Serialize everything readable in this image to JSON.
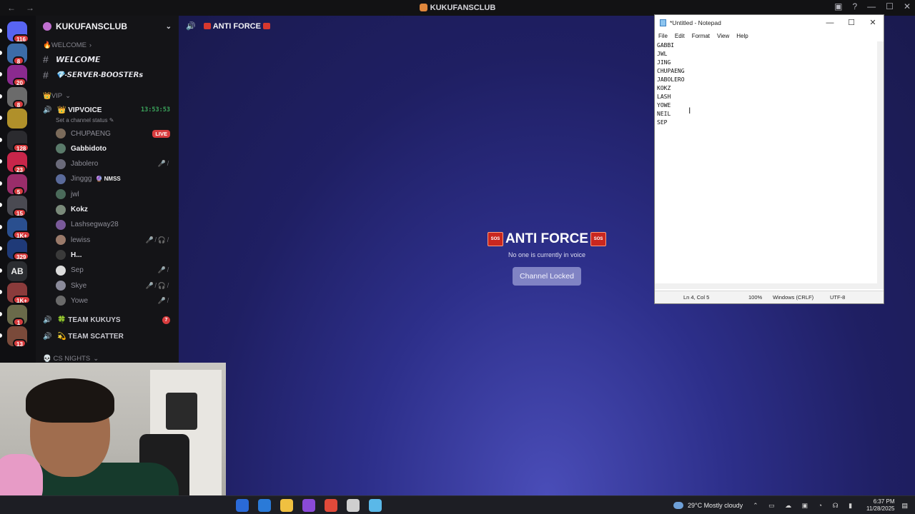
{
  "window": {
    "title": "KUKUFANSCLUB",
    "nav_back": "←",
    "nav_forward": "→",
    "controls": [
      "—",
      "☐",
      "✕"
    ]
  },
  "rail": {
    "servers": [
      {
        "badge": "116",
        "color": "#5865f2"
      },
      {
        "badge": "8",
        "color": "#3c6ca8"
      },
      {
        "badge": "20",
        "color": "#8b2a8f"
      },
      {
        "badge": "8",
        "color": "#6b6b6b"
      },
      {
        "badge": "",
        "color": "#b0902a"
      },
      {
        "badge": "128",
        "color": "#2b2b2f"
      },
      {
        "badge": "23",
        "color": "#c8264a"
      },
      {
        "badge": "5",
        "color": "#9a2d6a"
      },
      {
        "badge": "15",
        "color": "#4a4a52"
      },
      {
        "badge": "1K+",
        "color": "#2a4f8f"
      },
      {
        "badge": "329",
        "color": "#1f3a78"
      },
      {
        "badge": "",
        "color": "#2b2d31",
        "label": "AB"
      },
      {
        "badge": "1K+",
        "color": "#8a3b3b"
      },
      {
        "badge": "1",
        "color": "#6a6a4a"
      },
      {
        "badge": "13",
        "color": "#7a4a3a"
      }
    ]
  },
  "sidebar": {
    "guild_name": "KUKUFANSCLUB",
    "categories": {
      "welcome": "🔥WELCOME",
      "vip": "👑VIP",
      "cs_nights": "💀 CS NIGHTS"
    },
    "channels": [
      {
        "name": "𝙒𝙀𝙇𝘾𝙊𝙈𝙀"
      },
      {
        "name": "💎-𝙎𝙀𝙍𝙑𝙀𝙍-𝘽𝙊𝙊𝙎𝙏𝙀𝙍𝙨"
      }
    ],
    "voice": {
      "name": "👑 VIPVOICE",
      "timer": "13:53:53",
      "status_hint": "Set a channel status ✎"
    },
    "members": [
      {
        "name": "CHUPAENG",
        "live": "LIVE",
        "color": "#7a6a5a"
      },
      {
        "name": "Gabbidoto",
        "bright": true,
        "color": "#5a7a6a"
      },
      {
        "name": "Jabolero",
        "mutes": "🎤̸",
        "color": "#6a6a7a"
      },
      {
        "name": "Jinggg",
        "tag": "🔮 NMSS",
        "color": "#5a6a9a"
      },
      {
        "name": "jwl",
        "color": "#4a6a5a"
      },
      {
        "name": "Kokz",
        "bright": true,
        "color": "#7a8a7a"
      },
      {
        "name": "Lashsegway28",
        "color": "#7a5a9a"
      },
      {
        "name": "lewiss",
        "mutes": "🎤̸🎧̸",
        "color": "#9a7a6a"
      },
      {
        "name": "H...",
        "bright": true,
        "color": "#3a3a3a"
      },
      {
        "name": "Sep",
        "mutes": "🎤̸",
        "color": "#dcdcdc"
      },
      {
        "name": "Skye",
        "mutes": "🎤̸🎧̸",
        "color": "#8a8a9a"
      },
      {
        "name": "Yowe",
        "mutes": "🎤̸",
        "color": "#6a6a6a"
      }
    ],
    "team_channels": [
      {
        "name": "🍀 TEAM KUKUYS",
        "count": "7"
      },
      {
        "name": "💫 TEAM SCATTER",
        "count": ""
      }
    ]
  },
  "stage": {
    "header": "ANTI FORCE",
    "title": "ANTI FORCE",
    "sos": "SOS",
    "subtitle": "No one is currently in voice",
    "button": "Channel Locked"
  },
  "notepad": {
    "title": "*Untitled - Notepad",
    "menu": [
      "File",
      "Edit",
      "Format",
      "View",
      "Help"
    ],
    "lines": [
      "GABBI",
      "JWL",
      "JING",
      "CHUPAENG",
      "JABOLERO",
      "KOKZ",
      "LASH",
      "YOWE",
      "NEIL",
      "SEP"
    ],
    "status": {
      "position": "Ln 4, Col 5",
      "zoom": "100%",
      "eol": "Windows (CRLF)",
      "encoding": "UTF-8"
    }
  },
  "taskbar": {
    "apps": [
      "#2a6ad8",
      "#2a7ad8",
      "#f0c040",
      "#8a4ad8",
      "#e04a3a",
      "#cfcfcf",
      "#5ab8e8"
    ],
    "weather": "29°C  Mostly cloudy",
    "time": "6:37 PM",
    "date": "11/28/2025"
  }
}
